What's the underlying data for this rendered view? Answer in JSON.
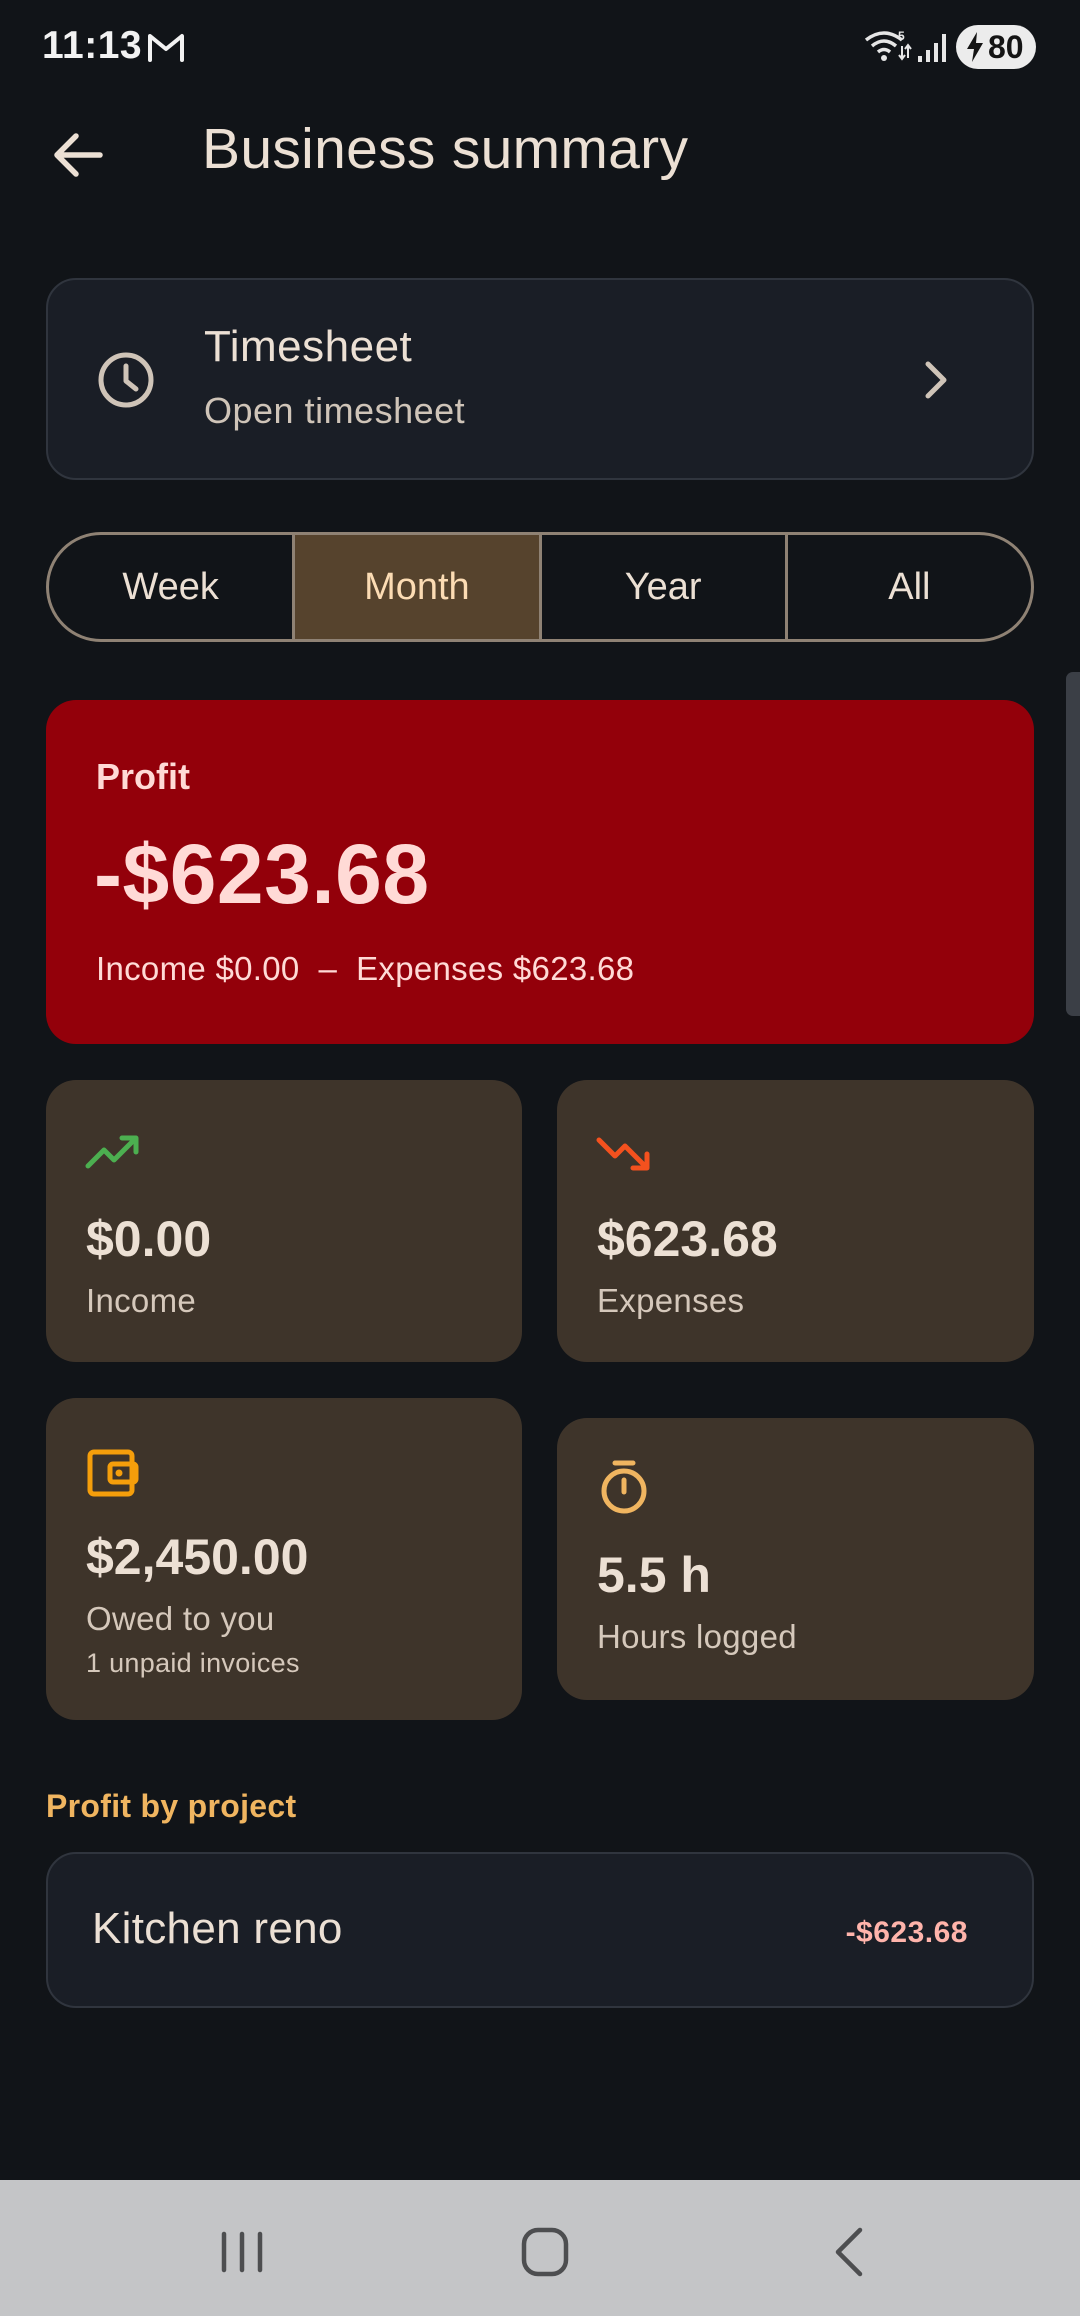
{
  "status_bar": {
    "time": "11:13",
    "battery_level": "80",
    "icons": [
      "gmail-icon",
      "wifi-icon",
      "signal-icon",
      "battery-icon"
    ]
  },
  "header": {
    "title": "Business summary",
    "back_icon": "arrow-left-icon"
  },
  "timesheet": {
    "title": "Timesheet",
    "subtitle": "Open timesheet",
    "icon": "clock-icon"
  },
  "period_tabs": [
    {
      "label": "Week",
      "selected": false
    },
    {
      "label": "Month",
      "selected": true
    },
    {
      "label": "Year",
      "selected": false
    },
    {
      "label": "All",
      "selected": false
    }
  ],
  "profit": {
    "label": "Profit",
    "value": "-$623.68",
    "breakdown": "Income $0.00  –  Expenses $623.68"
  },
  "stats": {
    "income": {
      "value": "$0.00",
      "label": "Income",
      "icon": "trending-up-icon",
      "icon_color": "#4caf50"
    },
    "expenses": {
      "value": "$623.68",
      "label": "Expenses",
      "icon": "trending-down-icon",
      "icon_color": "#f4511e"
    },
    "owed": {
      "value": "$2,450.00",
      "label": "Owed to you",
      "sub": "1 unpaid invoices",
      "icon": "wallet-icon",
      "icon_color": "#f59e0b"
    },
    "hours": {
      "value": "5.5 h",
      "label": "Hours logged",
      "icon": "timer-icon",
      "icon_color": "#f0b560"
    }
  },
  "profit_by_project": {
    "label": "Profit by project",
    "projects": [
      {
        "name": "Kitchen reno",
        "amount": "-$623.68"
      }
    ]
  },
  "colors": {
    "background": "#111418",
    "profit_card": "#93000a",
    "stat_card": "#3e342a",
    "selected_tab": "#56432d",
    "accent": "#f0b560"
  }
}
